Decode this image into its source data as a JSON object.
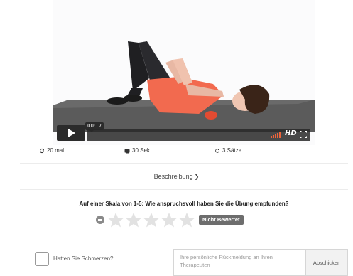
{
  "video": {
    "time_tip": "00:17",
    "hd_label": "HD",
    "icons": [
      "play-icon",
      "volume-icon",
      "fullscreen-icon"
    ]
  },
  "stats": {
    "reps": "20 mal",
    "duration": "30 Sek.",
    "sets": "3 Sätze",
    "icons": [
      "repeat-icon",
      "timer-icon",
      "refresh-icon"
    ]
  },
  "description": {
    "label": "Beschreibung",
    "icon": "chevron-down-icon"
  },
  "rating": {
    "question": "Auf einer Skala von 1-5: Wie anspruchsvoll haben Sie die Übung empfunden?",
    "max_stars": 5,
    "value": 0,
    "status_label": "Nicht Bewertet"
  },
  "feedback": {
    "pain_label": "Hatten Sie Schmerzen?",
    "placeholder": "Ihre persönliche Rückmeldung an Ihren Therapeuten",
    "submit_label": "Abschicken"
  },
  "colors": {
    "mat": "#5b5b5b",
    "shirt": "#f26a4f",
    "controls": "#2b2b2b",
    "badge": "#6d6d6d",
    "volume": "#f0633a"
  }
}
